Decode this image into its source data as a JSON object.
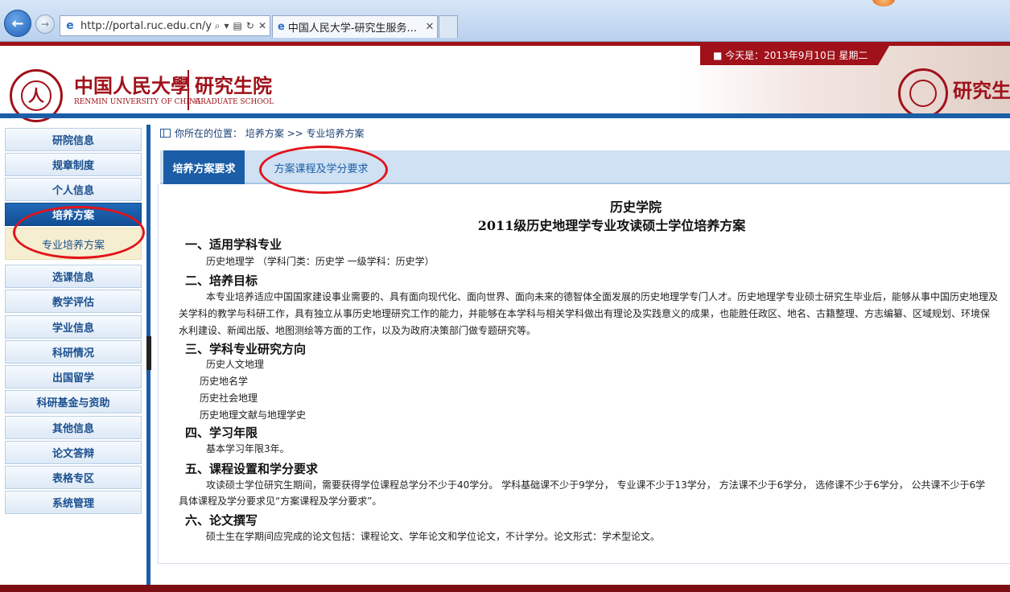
{
  "browser": {
    "url": "http://portal.ruc.edu.cn/y",
    "tab_title": "中国人民大学-研究生服务...",
    "back_icon": "back-arrow-icon",
    "forward_icon": "forward-arrow-icon",
    "address_tools": [
      "search-icon",
      "dropdown-icon",
      "compat-icon",
      "refresh-icon",
      "stop-icon"
    ],
    "address_tool_glyphs": [
      "⌕",
      "▾",
      "▤",
      "↻",
      "✕"
    ],
    "tab_close": "✕"
  },
  "header": {
    "logo_cn": "中国人民大學",
    "logo_cn2": "研究生院",
    "logo_en": "RENMIN UNIVERSITY OF CHINA",
    "logo_en2": "GRADUATE SCHOOL",
    "date_text": "■ 今天是：2013年9月10日  星期二",
    "right_title": "研究生",
    "brand_color": "#a0111a",
    "accent_color": "#1b5ea7"
  },
  "sidebar": {
    "items": [
      {
        "label": "研院信息"
      },
      {
        "label": "规章制度"
      },
      {
        "label": "个人信息"
      },
      {
        "label": "培养方案",
        "active": true
      },
      {
        "label": "专业培养方案",
        "sub": true
      },
      {
        "label": "选课信息"
      },
      {
        "label": "教学评估"
      },
      {
        "label": "学业信息"
      },
      {
        "label": "科研情况"
      },
      {
        "label": "出国留学"
      },
      {
        "label": "科研基金与资助"
      },
      {
        "label": "其他信息"
      },
      {
        "label": "论文答辩"
      },
      {
        "label": "表格专区"
      },
      {
        "label": "系统管理"
      }
    ]
  },
  "breadcrumb": {
    "text": "你所在的位置： 培养方案 >> 专业培养方案"
  },
  "tabs": {
    "requirements": "培养方案要求",
    "courses": "方案课程及学分要求"
  },
  "document": {
    "title1": "历史学院",
    "title2": "2011级历史地理学专业攻读硕士学位培养方案",
    "s1_heading": "一、适用学科专业",
    "s1_text": "历史地理学 （学科门类：历史学  一级学科：历史学）",
    "s2_heading": "二、培养目标",
    "s2_line1": "本专业培养适应中国国家建设事业需要的、具有面向现代化、面向世界、面向未来的德智体全面发展的历史地理学专门人才。历史地理学专业硕士研究生毕业后，能够从事中国历史地理及",
    "s2_line2": "关学科的教学与科研工作，具有独立从事历史地理研究工作的能力，并能够在本学科与相关学科做出有理论及实践意义的成果，也能胜任政区、地名、古籍整理、方志编纂、区域规划、环境保",
    "s2_line3": "水利建设、新闻出版、地图测绘等方面的工作，以及为政府决策部门做专题研究等。",
    "s3_heading": "三、学科专业研究方向",
    "s3_items": [
      "历史人文地理",
      "历史地名学",
      "历史社会地理",
      "历史地理文献与地理学史"
    ],
    "s4_heading": "四、学习年限",
    "s4_text": "基本学习年限3年。",
    "s5_heading": "五、课程设置和学分要求",
    "s5_line1": "攻读硕士学位研究生期间，需要获得学位课程总学分不少于40学分。 学科基础课不少于9学分， 专业课不少于13学分， 方法课不少于6学分， 选修课不少于6学分， 公共课不少于6学",
    "s5_line2": "具体课程及学分要求见“方案课程及学分要求”。",
    "s6_heading": "六、论文撰写",
    "s6_text": "硕士生在学期间应完成的论文包括：课程论文、学年论文和学位论文，不计学分。论文形式：学术型论文。"
  }
}
